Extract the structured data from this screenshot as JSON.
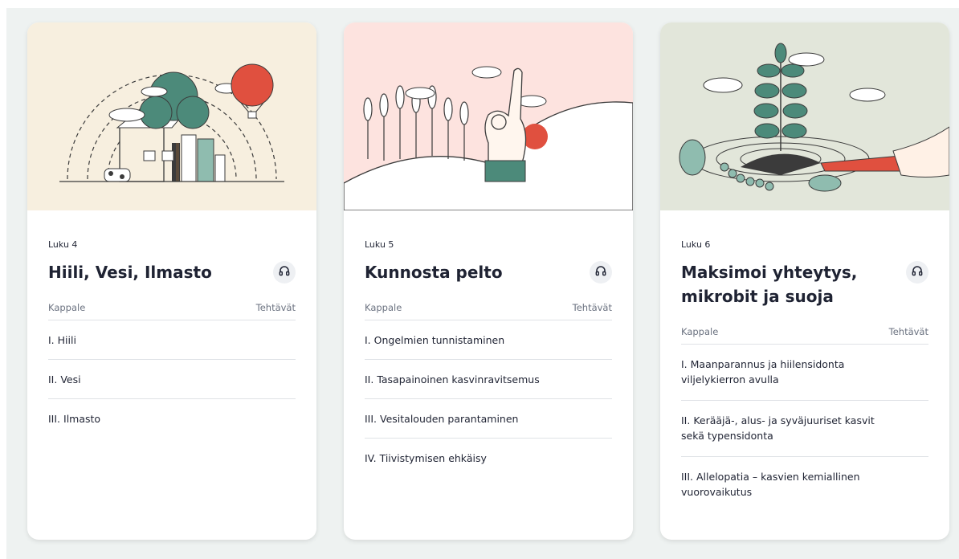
{
  "column_headers": {
    "section": "Kappale",
    "tasks": "Tehtävät"
  },
  "colors": {
    "card1_bg": "#f7efdf",
    "card2_bg": "#fde3df",
    "card3_bg": "#e2e6da",
    "accent_red": "#e0503f",
    "accent_teal": "#4c8a7a"
  },
  "cards": [
    {
      "chapter": "Luku 4",
      "title": "Hiili, Vesi, Ilmasto",
      "audio_icon": "headphones-icon",
      "illustration": "house-tree-balloon",
      "sections": [
        "I. Hiili",
        "II. Vesi",
        "III. Ilmasto"
      ]
    },
    {
      "chapter": "Luku 5",
      "title": "Kunnosta pelto",
      "audio_icon": "headphones-icon",
      "illustration": "wheat-field-ok-hand",
      "sections": [
        "I. Ongelmien tunnistaminen",
        "II. Tasapainoinen kasvinravitsemus",
        "III. Vesitalouden parantaminen",
        "IV. Tiivistymisen ehkäisy"
      ]
    },
    {
      "chapter": "Luku 6",
      "title": "Maksimoi yhteytys, mikrobit ja suoja",
      "audio_icon": "headphones-icon",
      "illustration": "plant-soil-trowel-microbes",
      "sections": [
        "I. Maanparannus ja hiilensidonta viljelykierron avulla",
        "II. Kerääjä-, alus- ja syväjuuriset kasvit sekä typensidonta",
        "III. Allelopatia – kasvien kemiallinen vuorovaikutus"
      ]
    }
  ]
}
